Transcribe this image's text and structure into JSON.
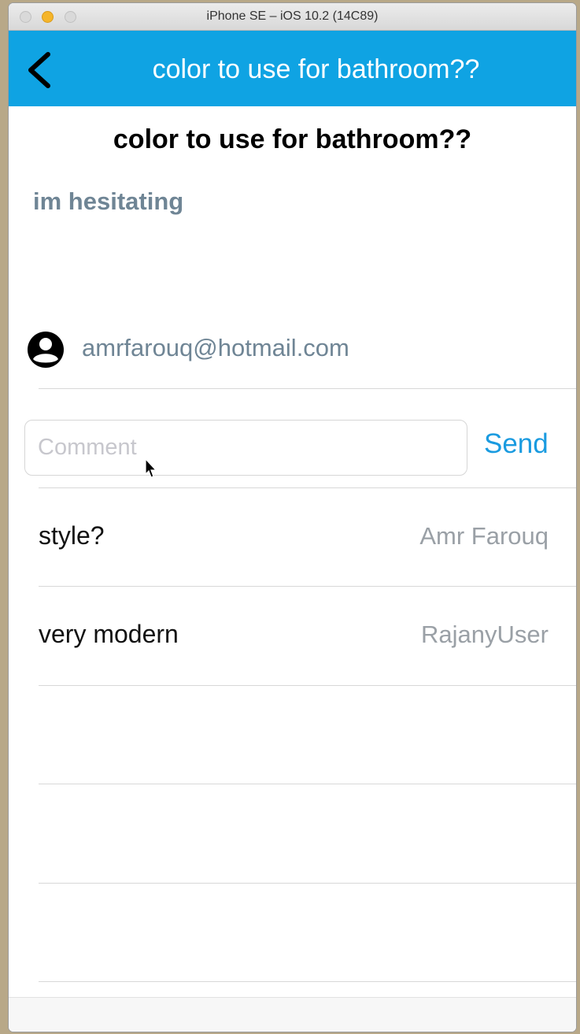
{
  "window": {
    "title": "iPhone SE – iOS 10.2 (14C89)"
  },
  "navbar": {
    "title": "color to use for bathroom??",
    "back_icon": "chevron-left-icon",
    "background": "#0fa3e3"
  },
  "post": {
    "title": "color to use for bathroom??",
    "body": "im hesitating",
    "author_icon": "user-circle-icon",
    "author_email": "amrfarouq@hotmail.com"
  },
  "comment_form": {
    "placeholder": "Comment",
    "value": "",
    "send_label": "Send",
    "accent": "#1a9be0"
  },
  "comments": [
    {
      "text": "style?",
      "author": "Amr Farouq"
    },
    {
      "text": "very modern",
      "author": "RajanyUser"
    }
  ]
}
